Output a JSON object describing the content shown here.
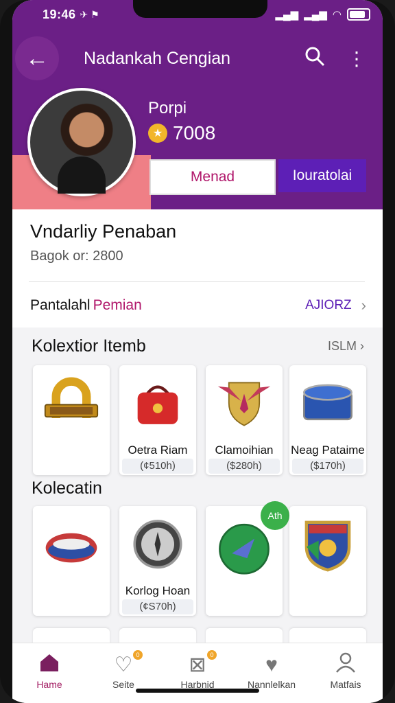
{
  "status": {
    "time": "19:46",
    "indicators": "✈ ⚑"
  },
  "header": {
    "title": "Nadankah Cengian"
  },
  "profile": {
    "name": "Porpi",
    "coins": "7008"
  },
  "buttons": {
    "primary_outline": "Menad",
    "primary_fill": "Iouratolai"
  },
  "info": {
    "title": "Vndarliy Penaban",
    "subtitle": "Bagok or: 2800"
  },
  "row": {
    "label_dark": "Pantalahl",
    "label_accent": "Pemian",
    "action": "AJIORZ"
  },
  "collection": {
    "title": "Kolextior Itemb",
    "more": "ISLM",
    "items": [
      {
        "name": "Oetra Riam",
        "price": "(¢510h)"
      },
      {
        "name": "Clamoihian",
        "price": "($280h)"
      },
      {
        "name": "",
        "price": ""
      },
      {
        "name": "Neag Pataime",
        "price": "($170h)"
      }
    ]
  },
  "collection2": {
    "title": "Kolecatin",
    "new_badge": "Ath",
    "items": [
      {
        "name": "Korlog Hoan",
        "price": "(¢S70h)"
      }
    ]
  },
  "nav": [
    {
      "label": "Hame",
      "icon": "home-icon"
    },
    {
      "label": "Seite",
      "icon": "heart-icon"
    },
    {
      "label": "Harbnid",
      "icon": "star-box-icon"
    },
    {
      "label": "Nannlelkan",
      "icon": "shield-heart-icon"
    },
    {
      "label": "Matfais",
      "icon": "person-icon"
    }
  ],
  "colors": {
    "accent": "#6b1f86",
    "pink": "#ef7f86",
    "button_purple": "#5d1fb6",
    "active_nav": "#a21c62"
  }
}
